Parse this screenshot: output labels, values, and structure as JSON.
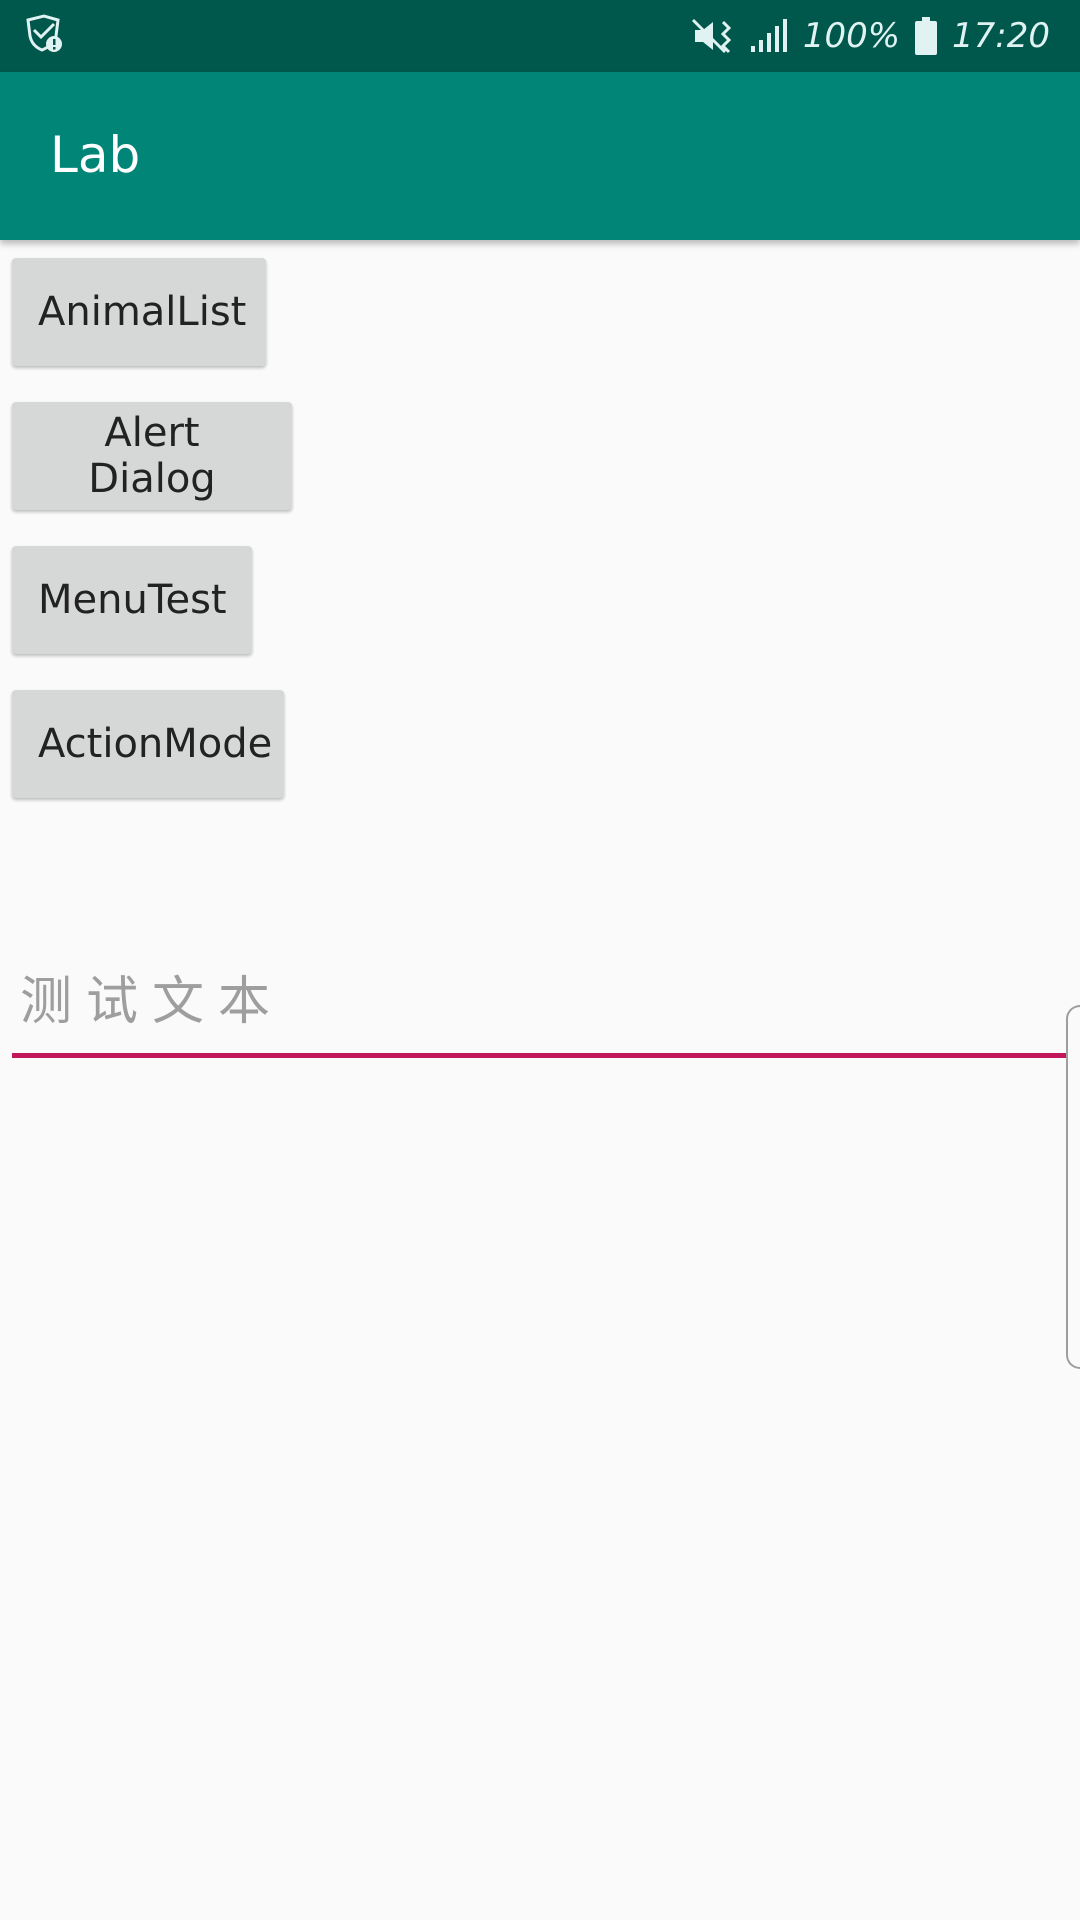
{
  "status_bar": {
    "battery_percent": "100%",
    "time": "17:20",
    "icons": [
      "security-shield-icon",
      "mute-icon",
      "signal-icon",
      "battery-icon"
    ]
  },
  "app_bar": {
    "title": "Lab",
    "color": "#008577"
  },
  "buttons": [
    {
      "label": "AnimalList"
    },
    {
      "label": "Alert Dialog"
    },
    {
      "label": "MenuTest"
    },
    {
      "label": "ActionMode"
    }
  ],
  "text_field": {
    "value": "",
    "placeholder": "测试文本",
    "underline_color": "#c2185b"
  }
}
